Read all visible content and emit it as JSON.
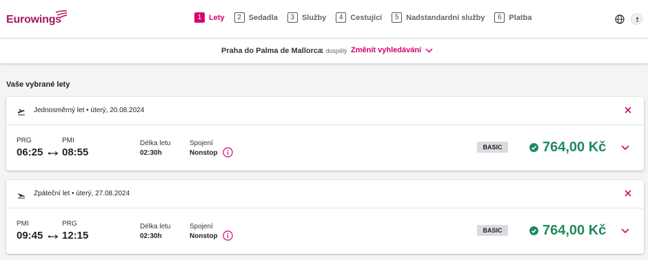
{
  "brand": {
    "name": "Eurowings",
    "color": "#a3195b",
    "accent": "#d6006d"
  },
  "steps": [
    {
      "num": "1",
      "label": "Lety",
      "active": true
    },
    {
      "num": "2",
      "label": "Sedadla",
      "active": false
    },
    {
      "num": "3",
      "label": "Služby",
      "active": false
    },
    {
      "num": "4",
      "label": "Cestující",
      "active": false
    },
    {
      "num": "5",
      "label": "Nadstandardní služby",
      "active": false
    },
    {
      "num": "6",
      "label": "Platba",
      "active": false
    }
  ],
  "search": {
    "route": "Praha do Palma de Mallorca",
    "passengers": "1 dospělý",
    "change_label": "Změnit vyhledávání"
  },
  "section_title": "Vaše vybrané lety",
  "flights": [
    {
      "header": "Jednosměrný let • úterý, 20.08.2024",
      "from_code": "PRG",
      "from_time": "06:25",
      "to_code": "PMI",
      "to_time": "08:55",
      "duration_label": "Délka letu",
      "duration": "02:30h",
      "connection_label": "Spojení",
      "connection": "Nonstop",
      "fare": "BASIC",
      "price": "764,00 Kč"
    },
    {
      "header": "Zpáteční let • úterý, 27.08.2024",
      "from_code": "PMI",
      "from_time": "09:45",
      "to_code": "PRG",
      "to_time": "12:15",
      "duration_label": "Délka letu",
      "duration": "02:30h",
      "connection_label": "Spojení",
      "connection": "Nonstop",
      "fare": "BASIC",
      "price": "764,00 Kč"
    }
  ],
  "icons": [
    "globe-icon",
    "user-icon",
    "chevron-down-icon",
    "plane-takeoff-icon",
    "plane-landing-icon",
    "close-icon",
    "info-icon",
    "check-circle-icon",
    "arrow-icon"
  ],
  "colors": {
    "price": "#1f8a5c",
    "badge": "#d9dbe0"
  }
}
